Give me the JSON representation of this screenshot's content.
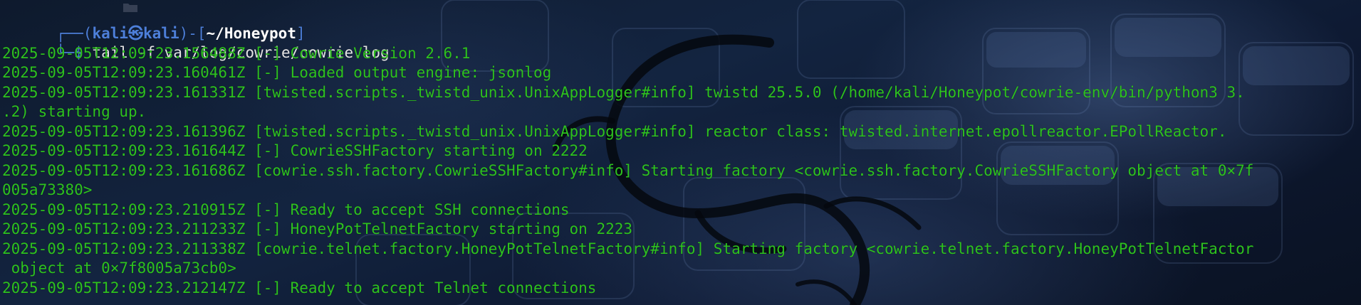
{
  "window": {
    "type": "terminal"
  },
  "prompt": {
    "frame_top_left": "┌──(",
    "user": "kali㉿kali",
    "frame_mid": ")-[",
    "path": "~/Honeypot",
    "frame_end": "]",
    "frame_bottom": "└─",
    "dollar": "$",
    "command": " tail -f var/log/cowrie/cowrie.log"
  },
  "log_lines": [
    "2025-09-05T12:09:23.156488Z [-] Cowrie Version 2.6.1",
    "2025-09-05T12:09:23.160461Z [-] Loaded output engine: jsonlog",
    "2025-09-05T12:09:23.161331Z [twisted.scripts._twistd_unix.UnixAppLogger#info] twistd 25.5.0 (/home/kali/Honeypot/cowrie-env/bin/python3 3.",
    ".2) starting up.",
    "2025-09-05T12:09:23.161396Z [twisted.scripts._twistd_unix.UnixAppLogger#info] reactor class: twisted.internet.epollreactor.EPollReactor.",
    "2025-09-05T12:09:23.161644Z [-] CowrieSSHFactory starting on 2222",
    "2025-09-05T12:09:23.161686Z [cowrie.ssh.factory.CowrieSSHFactory#info] Starting factory <cowrie.ssh.factory.CowrieSSHFactory object at 0×7f",
    "005a73380>",
    "2025-09-05T12:09:23.210915Z [-] Ready to accept SSH connections",
    "2025-09-05T12:09:23.211233Z [-] HoneyPotTelnetFactory starting on 2223",
    "2025-09-05T12:09:23.211338Z [cowrie.telnet.factory.HoneyPotTelnetFactory#info] Starting factory <cowrie.telnet.factory.HoneyPotTelnetFactor",
    " object at 0×7f8005a73cb0>",
    "2025-09-05T12:09:23.212147Z [-] Ready to accept Telnet connections"
  ],
  "colors": {
    "log_text": "#2ec21f",
    "prompt_accent": "#4d7fd9",
    "path_text": "#ffffff",
    "command_text": "#e6e6e6",
    "background": "#0e1a2d"
  }
}
